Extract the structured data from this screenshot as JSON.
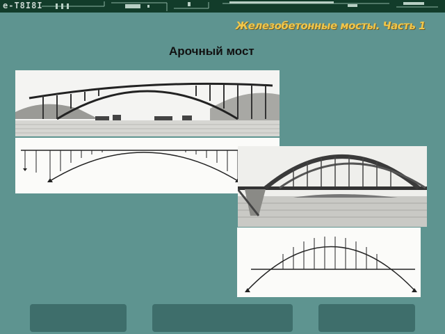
{
  "header": {
    "logo_text": "e-T8I8I",
    "deck_title": "Железобетонные мосты. Часть 1"
  },
  "slide": {
    "title": "Арочный мост"
  },
  "figures": [
    {
      "name": "photo-deck-arch-bridge"
    },
    {
      "name": "scheme-deck-arch-bridge"
    },
    {
      "name": "photo-through-arch-bridge"
    },
    {
      "name": "scheme-through-arch-bridge"
    }
  ],
  "nav": {
    "buttons": [
      "",
      "",
      ""
    ]
  },
  "colors": {
    "background": "#5e9490",
    "title_accent": "#f0c64a",
    "top_bar": "#123c2a",
    "nav_button": "#3e6e6b"
  }
}
